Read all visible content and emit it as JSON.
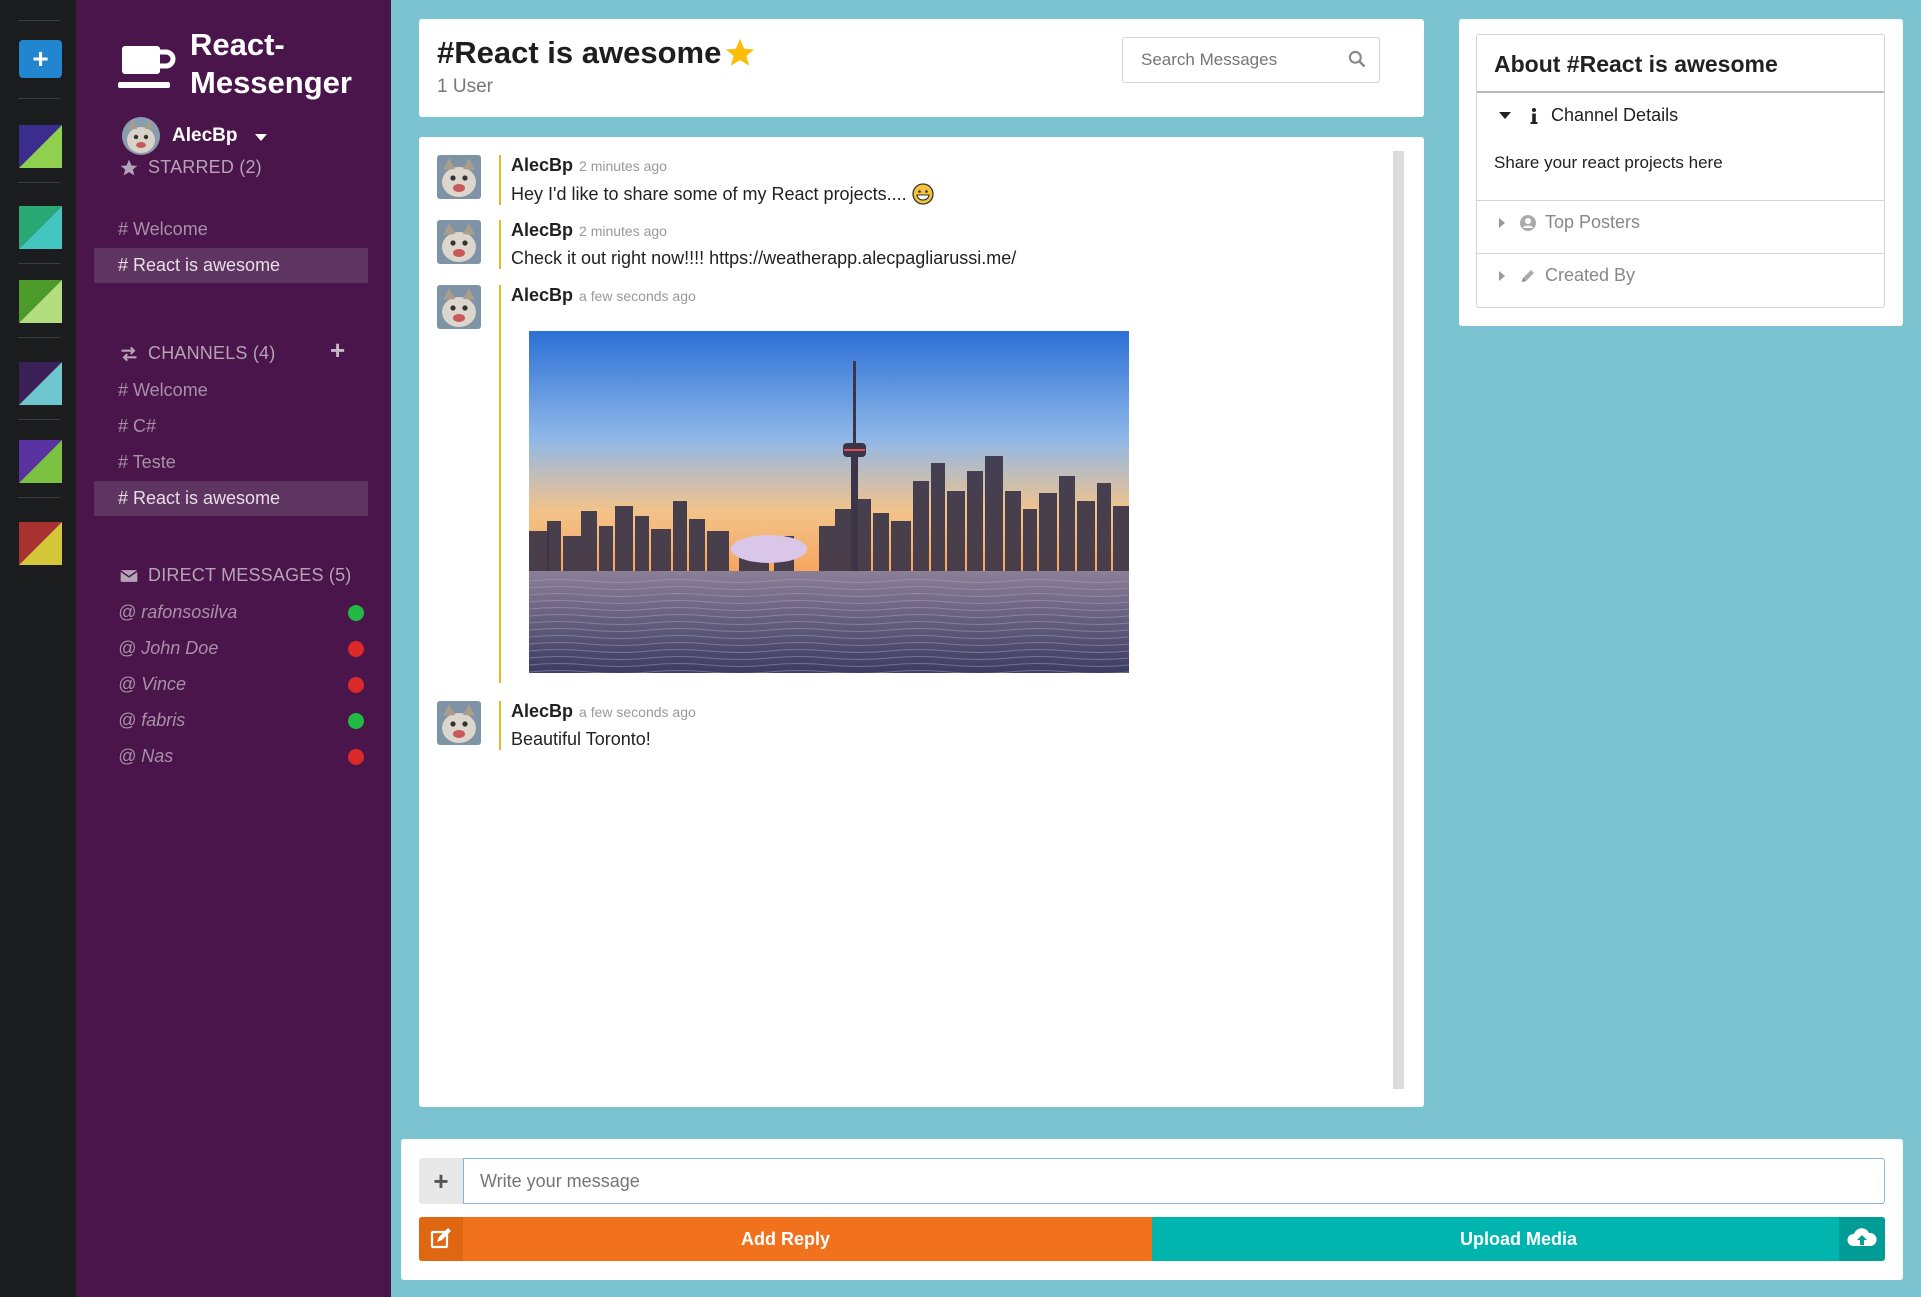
{
  "app": {
    "name": "React-Messenger",
    "name_line1": "React-",
    "name_line2": "Messenger"
  },
  "user": {
    "name": "AlecBp"
  },
  "rail": {
    "add_label": "+",
    "swatches": [
      {
        "primary": "#3b2c8f",
        "secondary": "#8fd14f"
      },
      {
        "primary": "#2aa876",
        "secondary": "#44c6c0"
      },
      {
        "primary": "#4c9a2a",
        "secondary": "#b4dd7f"
      },
      {
        "primary": "#3b1f57",
        "secondary": "#6ec6cf"
      },
      {
        "primary": "#5a31a1",
        "secondary": "#7cc242"
      },
      {
        "primary": "#a83232",
        "secondary": "#d4c83a"
      }
    ]
  },
  "sidebar": {
    "starred": {
      "header": "STARRED (2)",
      "items": [
        {
          "label": "# Welcome",
          "active": false
        },
        {
          "label": "# React is awesome",
          "active": true
        }
      ]
    },
    "channels": {
      "header": "CHANNELS (4)",
      "add_label": "+",
      "items": [
        {
          "label": "# Welcome",
          "active": false
        },
        {
          "label": "# C#",
          "active": false
        },
        {
          "label": "# Teste",
          "active": false
        },
        {
          "label": "# React is awesome",
          "active": true
        }
      ]
    },
    "direct_messages": {
      "header": "DIRECT MESSAGES (5)",
      "items": [
        {
          "label": "@ rafonsosilva",
          "status": "online"
        },
        {
          "label": "@ John Doe",
          "status": "offline"
        },
        {
          "label": "@ Vince",
          "status": "offline"
        },
        {
          "label": "@ fabris",
          "status": "online"
        },
        {
          "label": "@ Nas",
          "status": "offline"
        }
      ]
    }
  },
  "header": {
    "channel_title": "#React is awesome",
    "users_count": "1 User",
    "search_placeholder": "Search Messages"
  },
  "messages": [
    {
      "author": "AlecBp",
      "time": "2 minutes ago",
      "text": "Hey I'd like to share some of my React projects.... ",
      "emoji": "grinning-face"
    },
    {
      "author": "AlecBp",
      "time": "2 minutes ago",
      "text": "Check it out right now!!!! https://weatherapp.alecpagliarussi.me/"
    },
    {
      "author": "AlecBp",
      "time": "a few seconds ago",
      "image": "toronto-skyline"
    },
    {
      "author": "AlecBp",
      "time": "a few seconds ago",
      "text": "Beautiful Toronto!"
    }
  ],
  "meta": {
    "title": "About #React is awesome",
    "channel_details_label": "Channel Details",
    "channel_details_text": "Share your react projects here",
    "top_posters_label": "Top Posters",
    "created_by_label": "Created By"
  },
  "form": {
    "plus_label": "+",
    "input_placeholder": "Write your message",
    "add_reply_label": "Add Reply",
    "upload_media_label": "Upload Media"
  },
  "colors": {
    "sidebar_bg": "#4a154b",
    "rail_bg": "#1b1c1d",
    "page_bg": "#7bc3d1",
    "reply_orange": "#f2711c",
    "upload_teal": "#00b5ad",
    "online": "#21ba45",
    "offline": "#db2828",
    "message_accent": "#e9b62f"
  }
}
